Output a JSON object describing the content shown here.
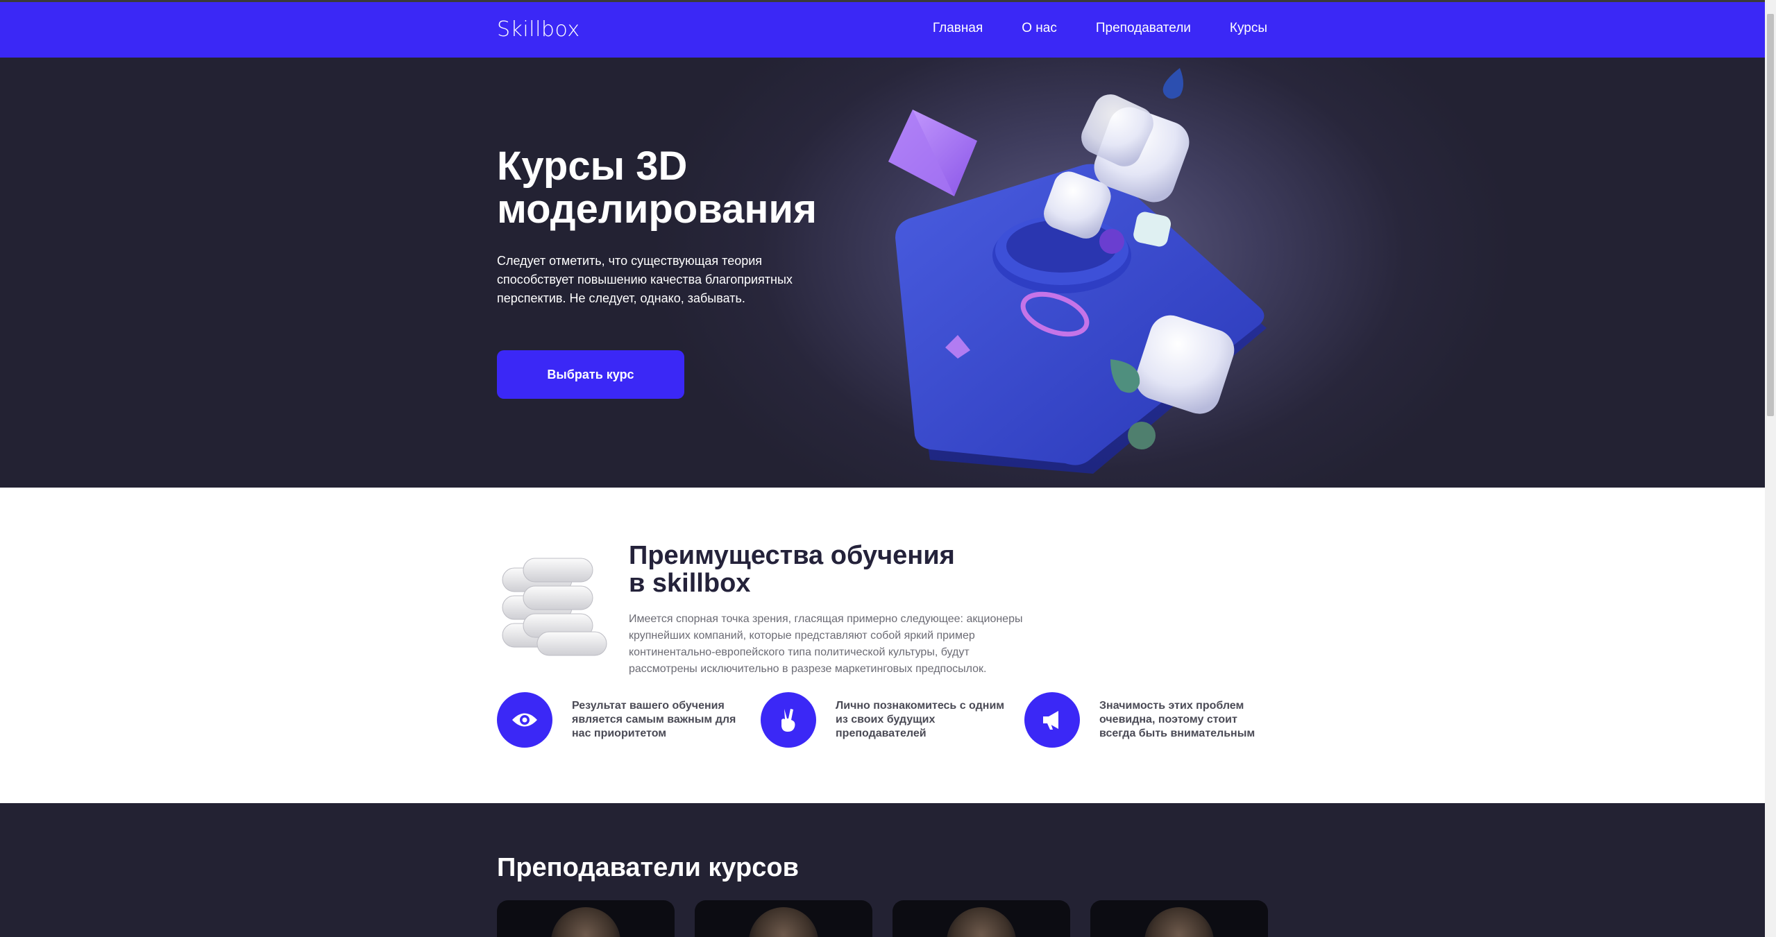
{
  "header": {
    "logo": "Skillbox",
    "nav": [
      "Главная",
      "О нас",
      "Преподаватели",
      "Курсы"
    ]
  },
  "hero": {
    "title": "Курсы 3D моделирования",
    "description": "Следует отметить, что существующая теория способствует повышению качества благоприятных перспектив. Не следует, однако, забывать.",
    "button": "Выбрать курс"
  },
  "advantages": {
    "title": "Преимущества обучения в skillbox",
    "description": "Имеется спорная точка зрения, гласящая примерно следующее: акционеры крупнейших компаний, которые представляют собой яркий пример континентально-европейского типа политической культуры, будут рассмотрены исключительно в разрезе маркетинговых предпосылок.",
    "features": [
      {
        "icon": "eye-icon",
        "text": "Результат вашего обучения является самым важным для нас приоритетом"
      },
      {
        "icon": "victory-hand-icon",
        "text": "Лично познакомитесь с одним из своих будущих преподавателей"
      },
      {
        "icon": "megaphone-icon",
        "text": "Значимость этих проблем очевидна, поэтому стоит всегда быть внимательным"
      }
    ]
  },
  "teachers": {
    "title": "Преподаватели курсов"
  },
  "colors": {
    "brand": "#3b28f6",
    "dark": "#232233"
  }
}
